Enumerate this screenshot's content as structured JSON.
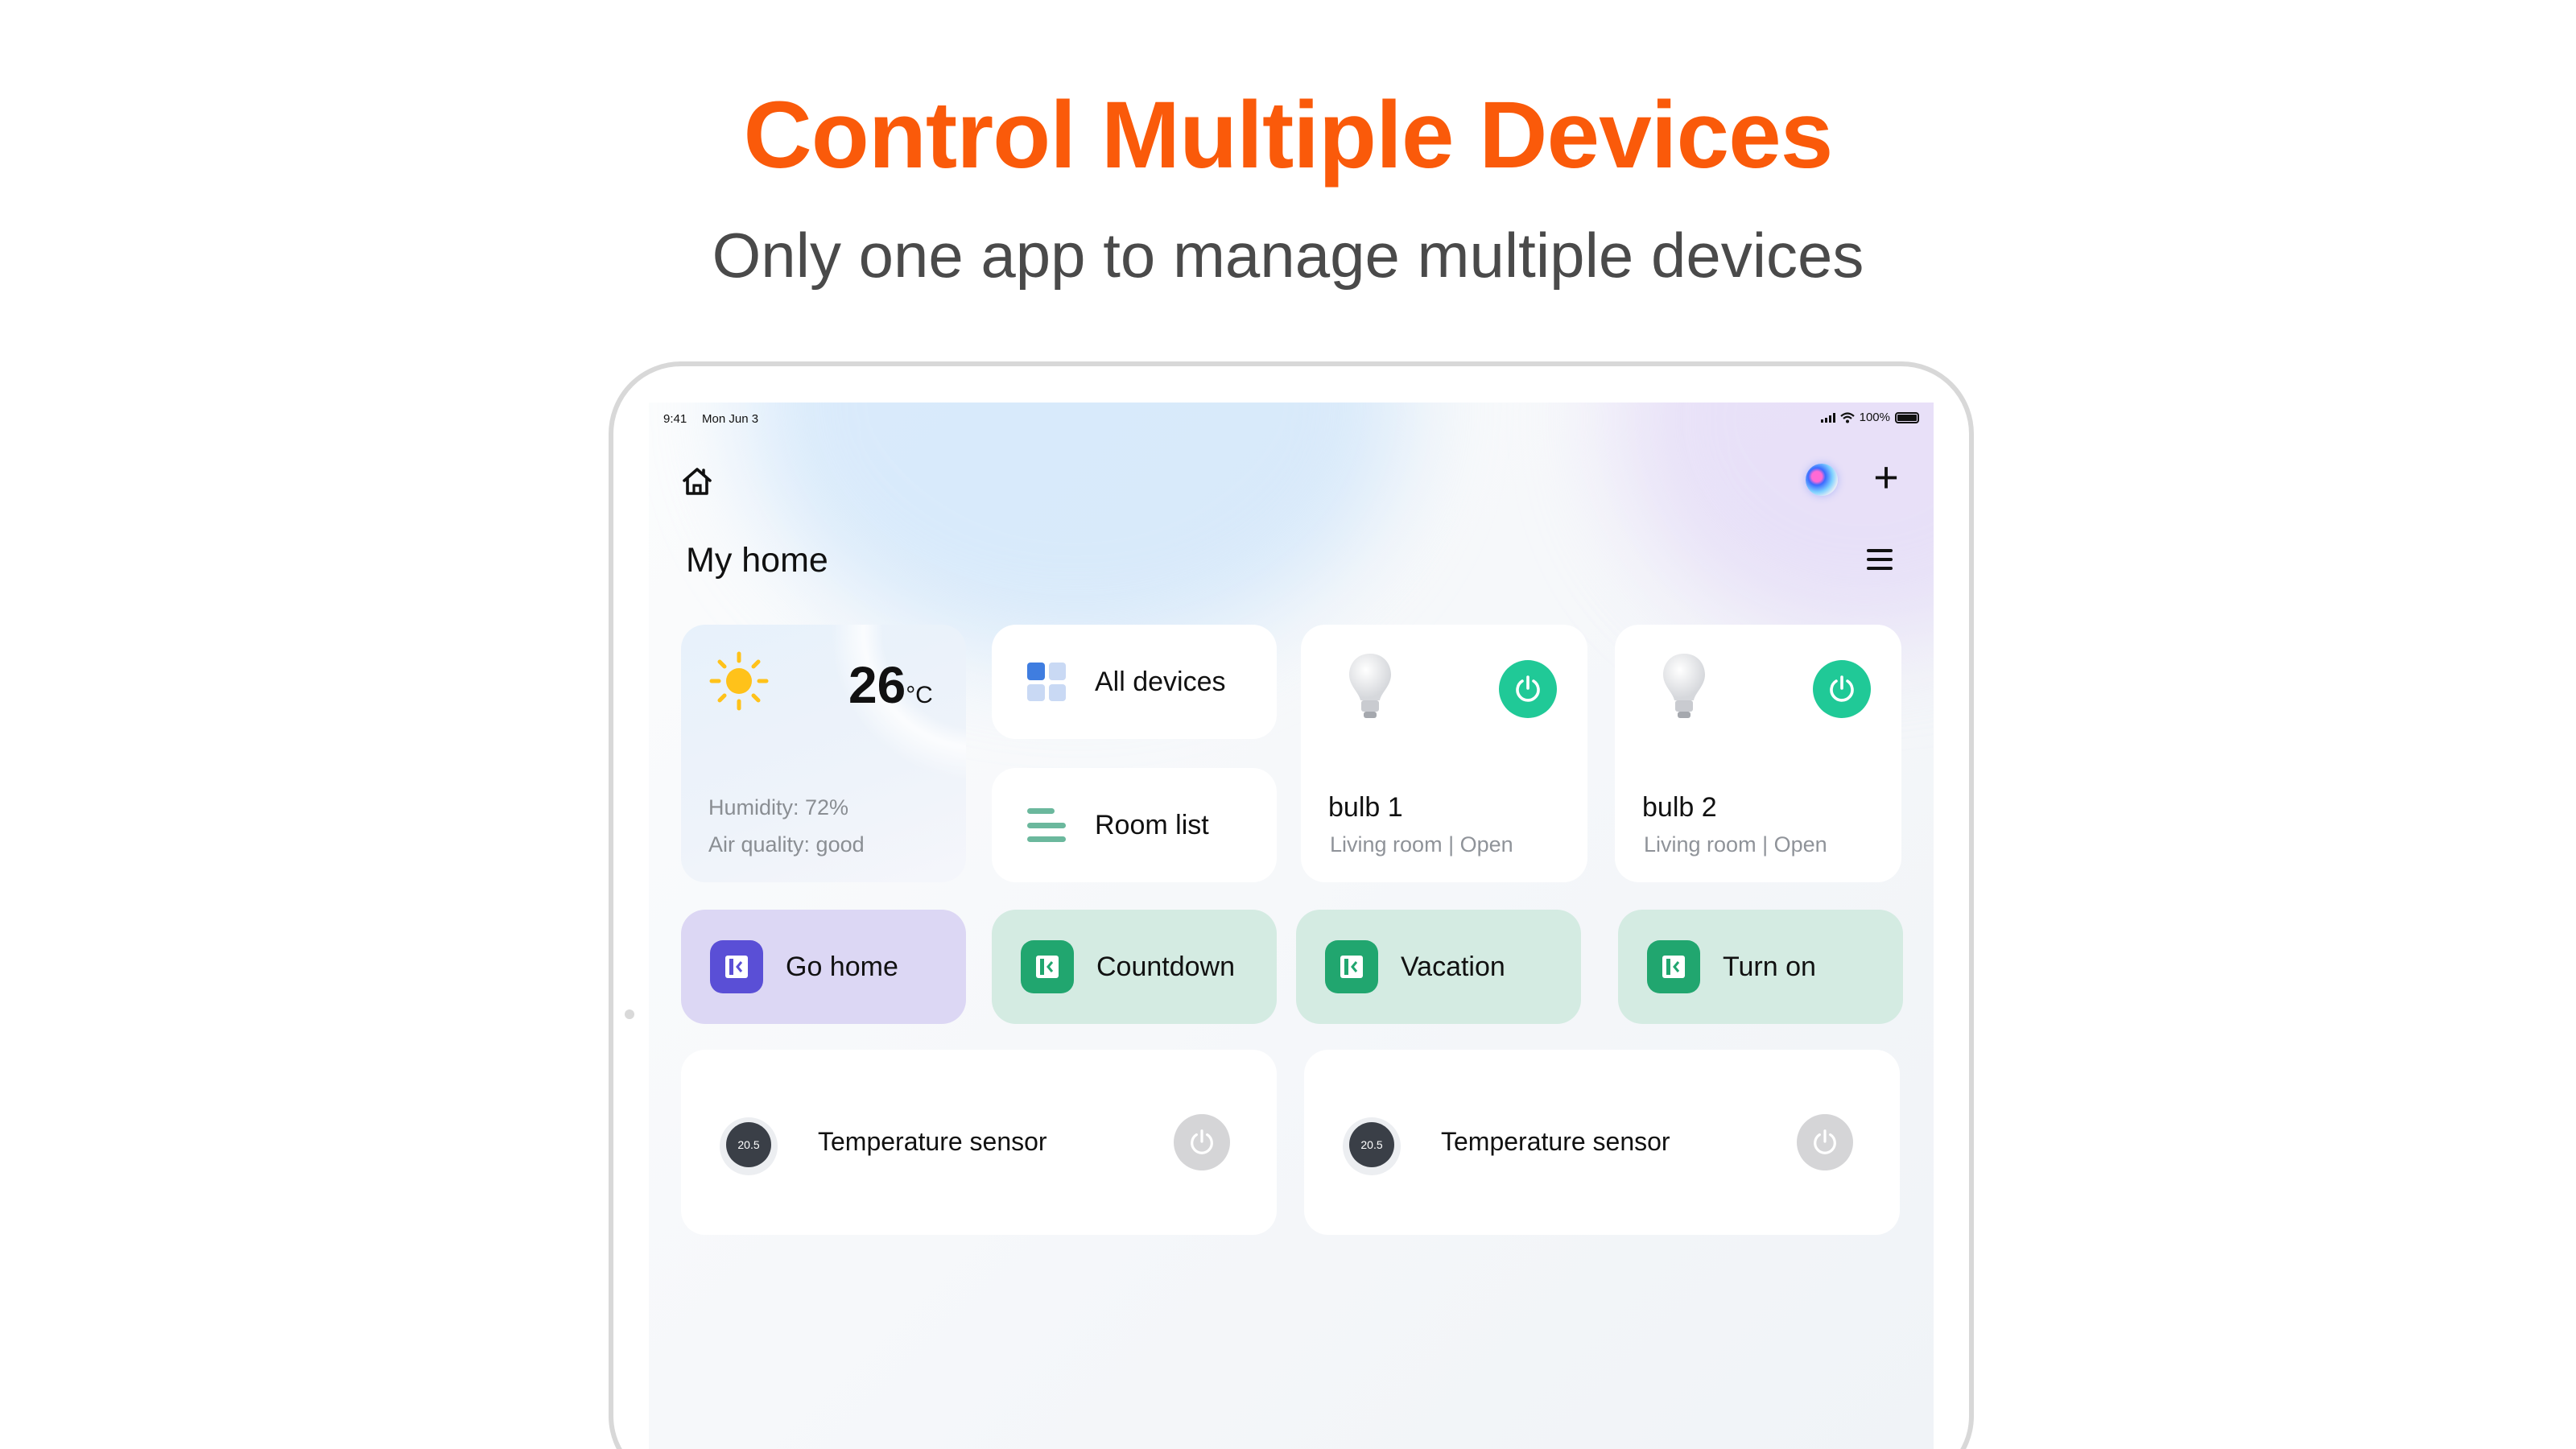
{
  "marketing": {
    "headline": "Control Multiple Devices",
    "subheadline": "Only one app to manage multiple devices"
  },
  "status_bar": {
    "time": "9:41",
    "date": "Mon Jun 3",
    "battery": "100%"
  },
  "header": {
    "title": "My home",
    "add_label": "+"
  },
  "weather": {
    "temperature": "26",
    "unit": "°C",
    "humidity": "Humidity: 72%",
    "air_quality": "Air quality: good"
  },
  "nav": {
    "all_devices": "All devices",
    "room_list": "Room list"
  },
  "bulbs": [
    {
      "name": "bulb 1",
      "status": "Living room | Open"
    },
    {
      "name": "bulb 2",
      "status": "Living room | Open"
    }
  ],
  "scenes": [
    {
      "label": "Go home",
      "color": "#5a4fd6"
    },
    {
      "label": "Countdown",
      "color": "#21a66f"
    },
    {
      "label": "Vacation",
      "color": "#21a66f"
    },
    {
      "label": "Turn on",
      "color": "#21a66f"
    }
  ],
  "sensors": [
    {
      "name": "Temperature sensor",
      "reading": "20.5"
    },
    {
      "name": "Temperature sensor",
      "reading": "20.5"
    }
  ],
  "colors": {
    "accent": "#fa5a0a",
    "power_on": "#20c997",
    "power_off": "#d5d5d7"
  },
  "icons": [
    "home-icon",
    "assistant-avatar-icon",
    "plus-icon",
    "menu-icon",
    "sun-icon",
    "grid-icon",
    "list-icon",
    "bulb-icon",
    "power-icon",
    "scene-icon",
    "thermostat-icon"
  ]
}
